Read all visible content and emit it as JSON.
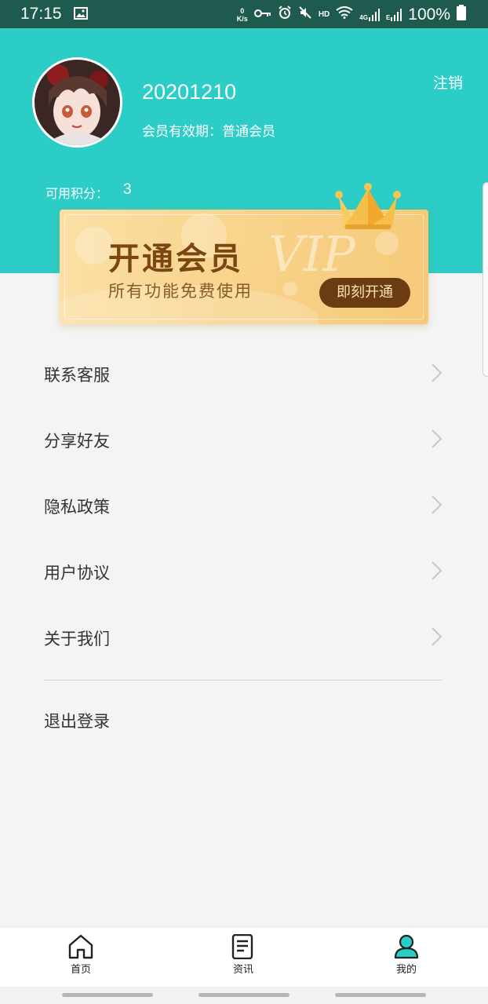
{
  "status_bar": {
    "time": "17:15",
    "speed_value": "0",
    "speed_unit": "K/s",
    "hd": "HD",
    "network": "4G",
    "network2": "E",
    "battery": "100%"
  },
  "profile": {
    "username": "20201210",
    "membership": "会员有效期：普通会员",
    "logout_label": "注销",
    "points_label": "可用积分：",
    "points_value": "3"
  },
  "vip_card": {
    "title": "开通会员",
    "subtitle": "所有功能免费使用",
    "watermark": "VIP",
    "button_label": "即刻开通"
  },
  "menu": {
    "items": [
      {
        "label": "联系客服"
      },
      {
        "label": "分享好友"
      },
      {
        "label": "隐私政策"
      },
      {
        "label": "用户协议"
      },
      {
        "label": "关于我们"
      }
    ],
    "logout": "退出登录"
  },
  "bottom_nav": {
    "items": [
      {
        "label": "首页",
        "icon": "home-icon"
      },
      {
        "label": "资讯",
        "icon": "news-icon"
      },
      {
        "label": "我的",
        "icon": "user-icon",
        "active": true
      }
    ]
  },
  "colors": {
    "header": "#2ccdc6",
    "status_bar": "#1f5a4f",
    "vip_button": "#6b3b12",
    "active_tab": "#2ccdc6"
  }
}
